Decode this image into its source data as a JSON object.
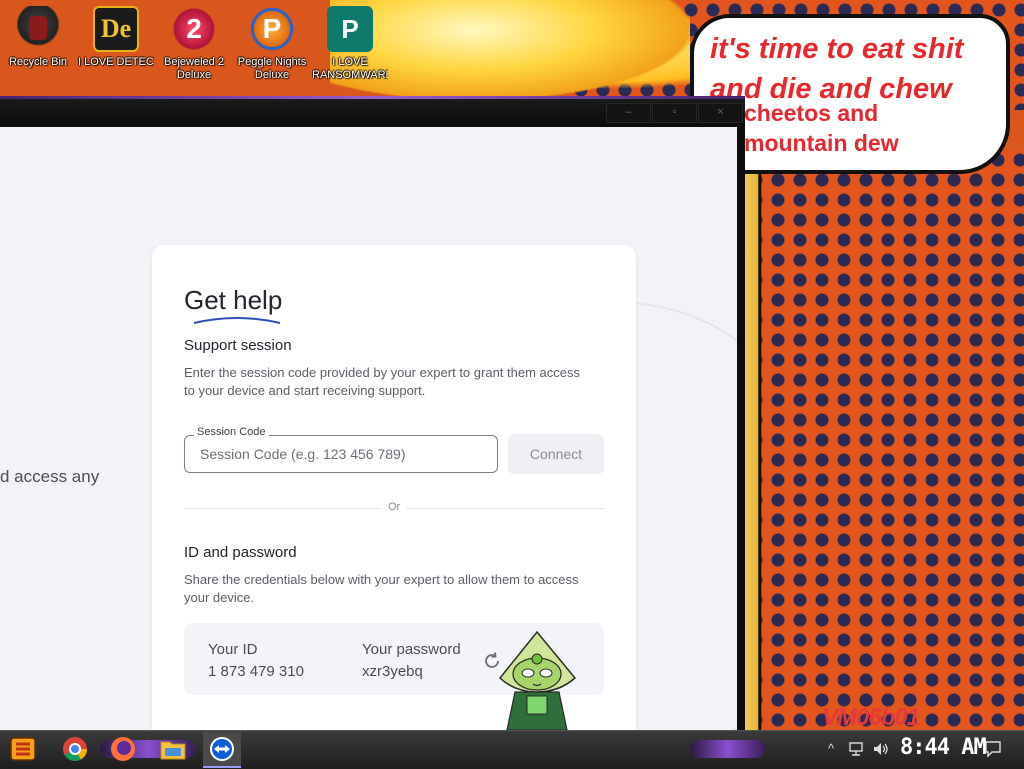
{
  "desktop": {
    "icons": [
      {
        "label": "Recycle Bin",
        "icon": "recycle-bin-icon"
      },
      {
        "label": "I LOVE DETECTING...",
        "icon": "detective-icon"
      },
      {
        "label": "Bejeweled 2 Deluxe",
        "icon": "bejeweled-icon"
      },
      {
        "label": "Peggle Nights Deluxe",
        "icon": "peggle-icon"
      },
      {
        "label": "I LOVE RANSOMWARE",
        "icon": "publisher-icon"
      }
    ],
    "icon_glyphs": {
      "de": "De",
      "bej": "2",
      "peg": "P",
      "pub": "P"
    },
    "wallpaper": {
      "bubble_line1": "it's time to eat shit",
      "bubble_line2": "and die and chew",
      "bubble_line3": "cheetos and",
      "bubble_line4": "mountain dew",
      "watermark": "VM06b01"
    }
  },
  "window": {
    "controls": [
      "–",
      "▫",
      "×"
    ],
    "side_text": "d access any",
    "card": {
      "title": "Get help",
      "support": {
        "heading": "Support session",
        "description": "Enter the session code provided by your expert to grant them access to your device and start receiving support.",
        "field_label": "Session Code",
        "placeholder": "Session Code (e.g. 123 456 789)",
        "connect_label": "Connect"
      },
      "divider": "Or",
      "credentials": {
        "heading": "ID and password",
        "description": "Share the credentials below with your expert to allow them to access your device.",
        "id_label": "Your ID",
        "id_value": "1 873 479 310",
        "password_label": "Your password",
        "password_value": "xzr3yebq"
      }
    }
  },
  "taskbar": {
    "clock": "8:44 AM",
    "tray_up": "^"
  },
  "colors": {
    "accent_purple": "#8a4fd0",
    "wallpaper_orange": "#e2561d",
    "bubble_text": "#e6282d"
  }
}
